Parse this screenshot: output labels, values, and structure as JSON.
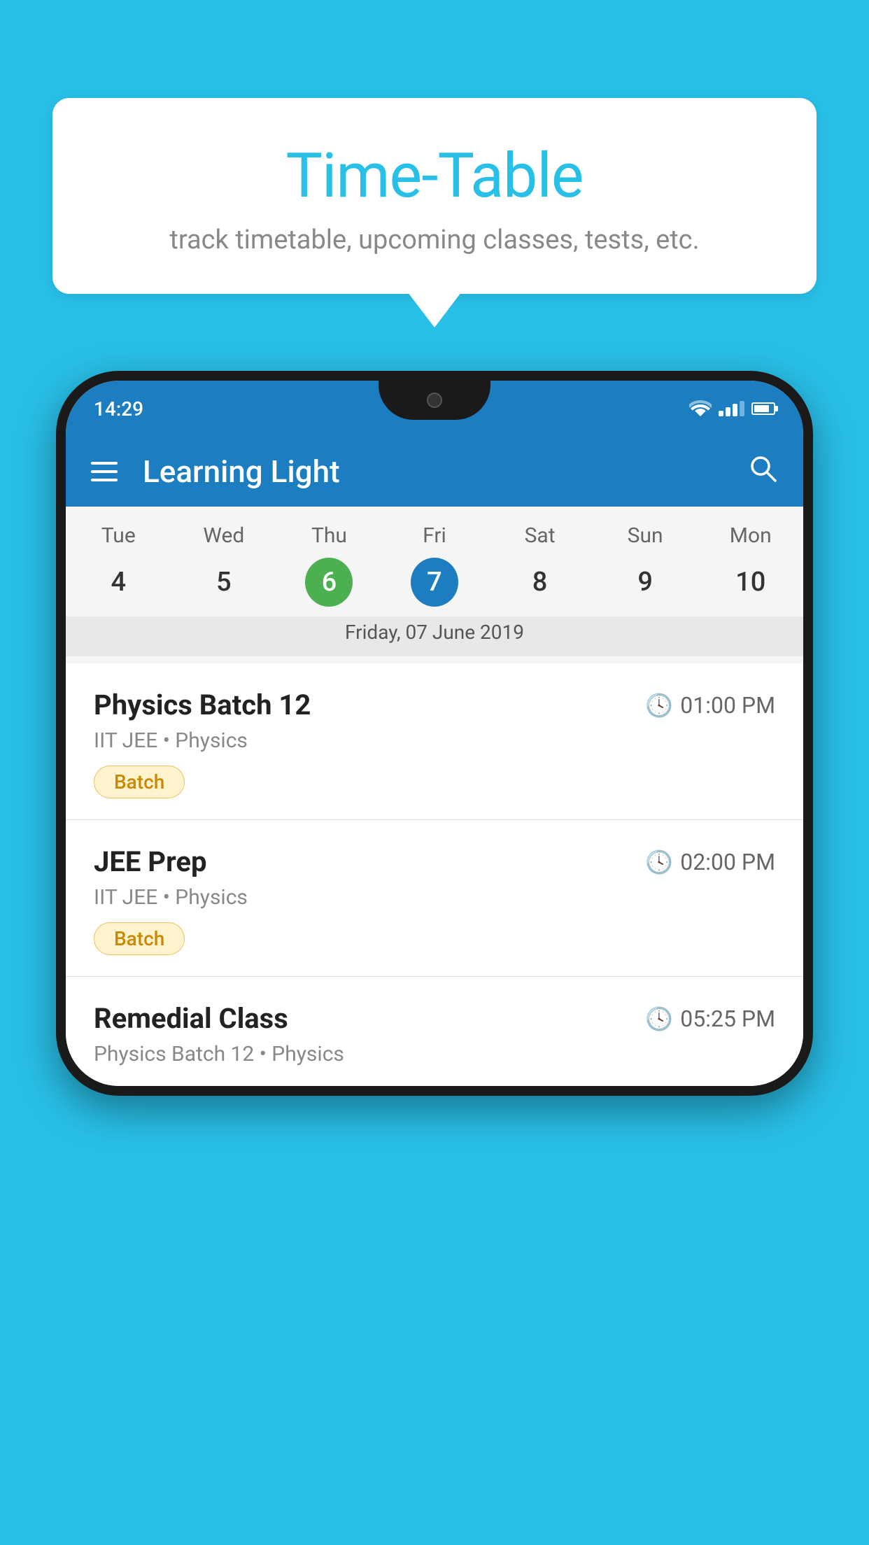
{
  "background_color": "#29C0E8",
  "bubble": {
    "title": "Time-Table",
    "subtitle": "track timetable, upcoming classes, tests, etc."
  },
  "phone": {
    "status_bar": {
      "time": "14:29"
    },
    "app_bar": {
      "title": "Learning Light"
    },
    "calendar": {
      "days": [
        {
          "name": "Tue",
          "num": "4",
          "state": "normal"
        },
        {
          "name": "Wed",
          "num": "5",
          "state": "normal"
        },
        {
          "name": "Thu",
          "num": "6",
          "state": "today"
        },
        {
          "name": "Fri",
          "num": "7",
          "state": "selected"
        },
        {
          "name": "Sat",
          "num": "8",
          "state": "normal"
        },
        {
          "name": "Sun",
          "num": "9",
          "state": "normal"
        },
        {
          "name": "Mon",
          "num": "10",
          "state": "normal"
        }
      ],
      "selected_date_label": "Friday, 07 June 2019"
    },
    "schedule": [
      {
        "title": "Physics Batch 12",
        "time": "01:00 PM",
        "sub": "IIT JEE • Physics",
        "badge": "Batch"
      },
      {
        "title": "JEE Prep",
        "time": "02:00 PM",
        "sub": "IIT JEE • Physics",
        "badge": "Batch"
      },
      {
        "title": "Remedial Class",
        "time": "05:25 PM",
        "sub": "Physics Batch 12 • Physics",
        "badge": null
      }
    ]
  }
}
